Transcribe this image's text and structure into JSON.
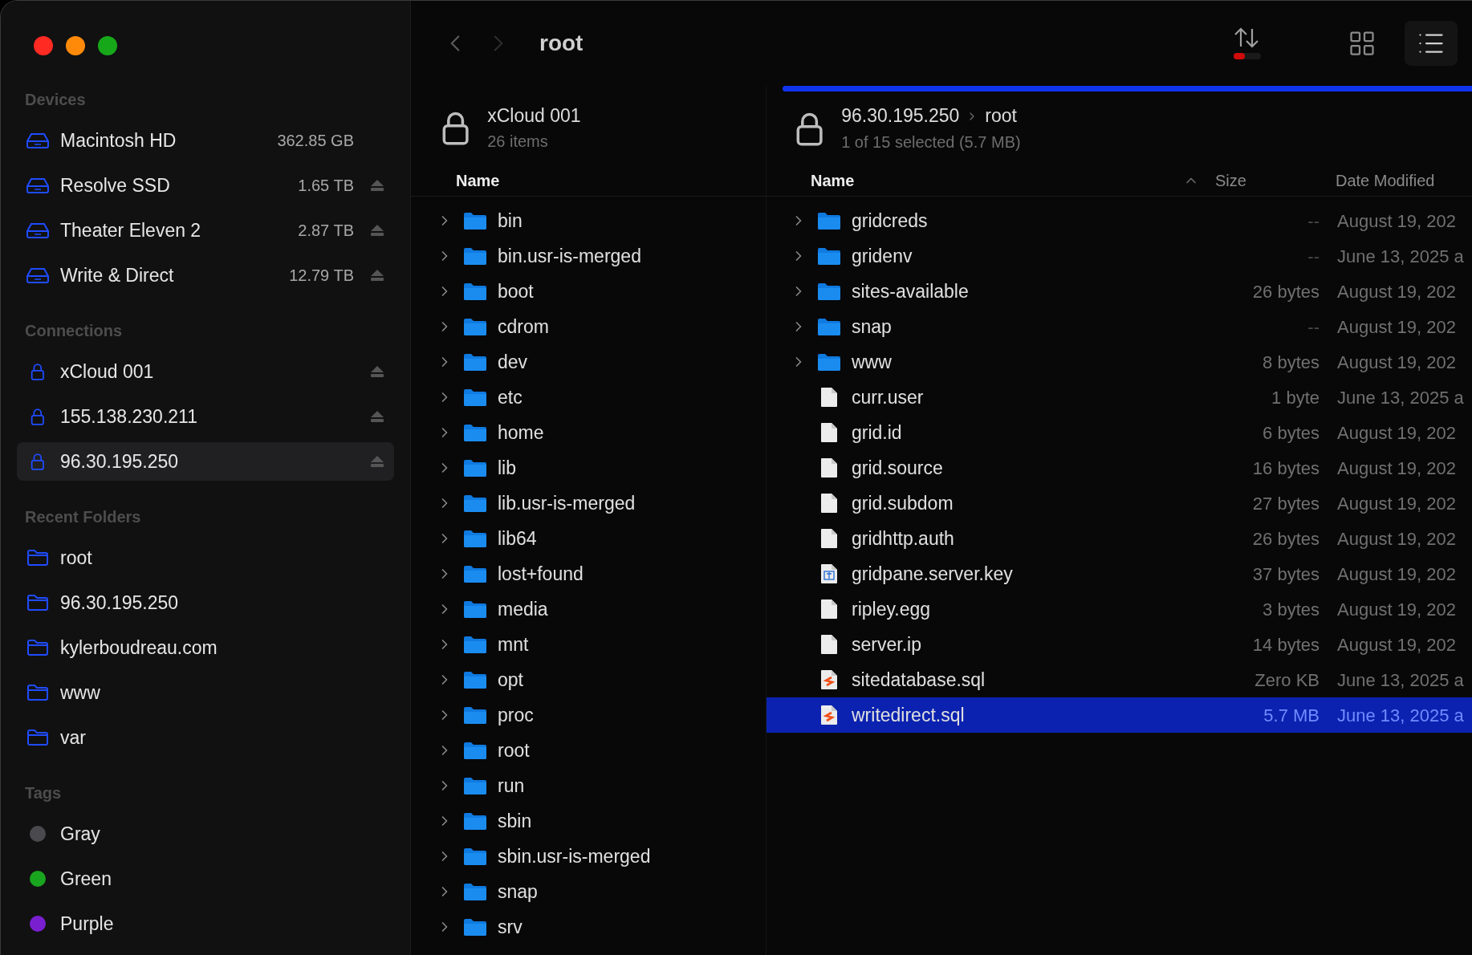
{
  "window": {
    "title": "root"
  },
  "navigation": {
    "back": {
      "disabled": false
    },
    "forward": {
      "disabled": true
    }
  },
  "view_modes": [
    {
      "kind": "grid",
      "selected": false
    },
    {
      "kind": "list",
      "selected": true
    }
  ],
  "sidebar": {
    "sections": [
      {
        "title": "Devices",
        "items": [
          {
            "kind": "drive",
            "label": "Macintosh HD",
            "capacity": "362.85 GB",
            "ejectable": false,
            "selected": false
          },
          {
            "kind": "drive",
            "label": "Resolve SSD",
            "capacity": "1.65 TB",
            "ejectable": true,
            "selected": false
          },
          {
            "kind": "drive",
            "label": "Theater Eleven 2",
            "capacity": "2.87 TB",
            "ejectable": true,
            "selected": false
          },
          {
            "kind": "drive",
            "label": "Write & Direct",
            "capacity": "12.79 TB",
            "ejectable": true,
            "selected": false
          }
        ]
      },
      {
        "title": "Connections",
        "items": [
          {
            "kind": "connection",
            "label": "xCloud 001",
            "ejectable": true,
            "selected": false
          },
          {
            "kind": "connection",
            "label": "155.138.230.211",
            "ejectable": true,
            "selected": false
          },
          {
            "kind": "connection",
            "label": "96.30.195.250",
            "ejectable": true,
            "selected": true
          }
        ]
      },
      {
        "title": "Recent Folders",
        "items": [
          {
            "kind": "folder",
            "label": "root",
            "selected": false
          },
          {
            "kind": "folder",
            "label": "96.30.195.250",
            "selected": false
          },
          {
            "kind": "folder",
            "label": "kylerboudreau.com",
            "selected": false
          },
          {
            "kind": "folder",
            "label": "www",
            "selected": false
          },
          {
            "kind": "folder",
            "label": "var",
            "selected": false
          }
        ]
      },
      {
        "title": "Tags",
        "items": [
          {
            "kind": "tag",
            "label": "Gray",
            "color": "#4a4a4e",
            "selected": false
          },
          {
            "kind": "tag",
            "label": "Green",
            "color": "#1aa51f",
            "selected": false
          },
          {
            "kind": "tag",
            "label": "Purple",
            "color": "#7a1fd0",
            "selected": false
          }
        ]
      }
    ]
  },
  "left_pane": {
    "title": "xCloud 001",
    "subtitle": "26 items",
    "name_column": "Name",
    "rows": [
      {
        "name": "bin",
        "kind": "folder",
        "expanded": false,
        "selected": false
      },
      {
        "name": "bin.usr-is-merged",
        "kind": "folder",
        "expanded": false,
        "selected": false
      },
      {
        "name": "boot",
        "kind": "folder",
        "expanded": false,
        "selected": false
      },
      {
        "name": "cdrom",
        "kind": "folder",
        "expanded": false,
        "selected": false
      },
      {
        "name": "dev",
        "kind": "folder",
        "expanded": false,
        "selected": false
      },
      {
        "name": "etc",
        "kind": "folder",
        "expanded": false,
        "selected": false
      },
      {
        "name": "home",
        "kind": "folder",
        "expanded": false,
        "selected": false
      },
      {
        "name": "lib",
        "kind": "folder",
        "expanded": false,
        "selected": false
      },
      {
        "name": "lib.usr-is-merged",
        "kind": "folder",
        "expanded": false,
        "selected": false
      },
      {
        "name": "lib64",
        "kind": "folder",
        "expanded": false,
        "selected": false
      },
      {
        "name": "lost+found",
        "kind": "folder",
        "expanded": false,
        "selected": false
      },
      {
        "name": "media",
        "kind": "folder",
        "expanded": false,
        "selected": false
      },
      {
        "name": "mnt",
        "kind": "folder",
        "expanded": false,
        "selected": false
      },
      {
        "name": "opt",
        "kind": "folder",
        "expanded": false,
        "selected": false
      },
      {
        "name": "proc",
        "kind": "folder",
        "expanded": false,
        "selected": false
      },
      {
        "name": "root",
        "kind": "folder",
        "expanded": false,
        "selected": false
      },
      {
        "name": "run",
        "kind": "folder",
        "expanded": false,
        "selected": false
      },
      {
        "name": "sbin",
        "kind": "folder",
        "expanded": false,
        "selected": false
      },
      {
        "name": "sbin.usr-is-merged",
        "kind": "folder",
        "expanded": false,
        "selected": false
      },
      {
        "name": "snap",
        "kind": "folder",
        "expanded": false,
        "selected": false
      },
      {
        "name": "srv",
        "kind": "folder",
        "expanded": false,
        "selected": false
      }
    ]
  },
  "right_pane": {
    "path": [
      "96.30.195.250",
      "root"
    ],
    "subtitle": "1 of 15 selected (5.7 MB)",
    "columns": {
      "name": "Name",
      "size": "Size",
      "date": "Date Modified"
    },
    "rows": [
      {
        "name": "gridcreds",
        "kind": "folder",
        "expanded": false,
        "size": "--",
        "date": "August 19, 202",
        "selected": false
      },
      {
        "name": "gridenv",
        "kind": "folder",
        "expanded": false,
        "size": "--",
        "date": "June 13, 2025 a",
        "selected": false
      },
      {
        "name": "sites-available",
        "kind": "folder",
        "expanded": false,
        "size": "26 bytes",
        "date": "August 19, 202",
        "selected": false
      },
      {
        "name": "snap",
        "kind": "folder",
        "expanded": false,
        "size": "--",
        "date": "August 19, 202",
        "selected": false
      },
      {
        "name": "www",
        "kind": "folder",
        "expanded": false,
        "size": "8 bytes",
        "date": "August 19, 202",
        "selected": false
      },
      {
        "name": "curr.user",
        "kind": "file",
        "size": "1 byte",
        "date": "June 13, 2025 a",
        "selected": false
      },
      {
        "name": "grid.id",
        "kind": "file",
        "size": "6 bytes",
        "date": "August 19, 202",
        "selected": false
      },
      {
        "name": "grid.source",
        "kind": "file",
        "size": "16 bytes",
        "date": "August 19, 202",
        "selected": false
      },
      {
        "name": "grid.subdom",
        "kind": "file",
        "size": "27 bytes",
        "date": "August 19, 202",
        "selected": false
      },
      {
        "name": "gridhttp.auth",
        "kind": "file",
        "size": "26 bytes",
        "date": "August 19, 202",
        "selected": false
      },
      {
        "name": "gridpane.server.key",
        "kind": "key",
        "size": "37 bytes",
        "date": "August 19, 202",
        "selected": false
      },
      {
        "name": "ripley.egg",
        "kind": "file",
        "size": "3 bytes",
        "date": "August 19, 202",
        "selected": false
      },
      {
        "name": "server.ip",
        "kind": "file",
        "size": "14 bytes",
        "date": "August 19, 202",
        "selected": false
      },
      {
        "name": "sitedatabase.sql",
        "kind": "sql",
        "size": "Zero KB",
        "date": "June 13, 2025 a",
        "selected": false
      },
      {
        "name": "writedirect.sql",
        "kind": "sql",
        "size": "5.7 MB",
        "date": "June 13, 2025 a",
        "selected": true
      }
    ]
  }
}
